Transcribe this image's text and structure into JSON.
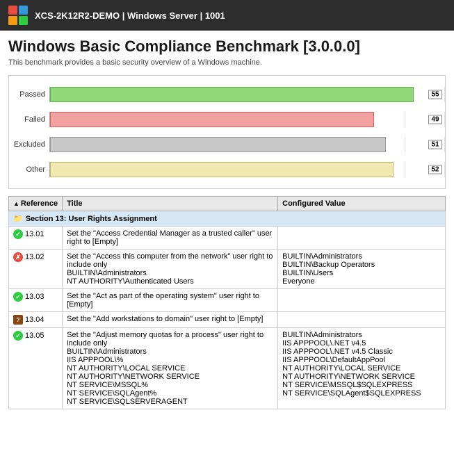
{
  "header": {
    "title": "XCS-2K12R2-DEMO | Windows Server | 1001",
    "icon_colors": [
      "#e74c3c",
      "#3498db",
      "#f39c12",
      "#2ecc40"
    ]
  },
  "page": {
    "title": "Windows Basic Compliance Benchmark [3.0.0.0]",
    "subtitle": "This benchmark provides a basic security overview of a Windows machine."
  },
  "chart": {
    "bars": [
      {
        "label": "Passed",
        "value": 55,
        "color": "#90d878",
        "border": "#5ab84b",
        "pct": 92
      },
      {
        "label": "Failed",
        "value": 49,
        "color": "#f2a0a0",
        "border": "#e06060",
        "pct": 82
      },
      {
        "label": "Excluded",
        "value": 51,
        "color": "#c8c8c8",
        "border": "#999",
        "pct": 85
      },
      {
        "label": "Other",
        "value": 52,
        "color": "#f0e8b0",
        "border": "#c8b860",
        "pct": 87
      }
    ]
  },
  "table": {
    "headers": {
      "reference": "Reference",
      "title": "Title",
      "configured_value": "Configured Value"
    },
    "section_label": "Section 13: User Rights Assignment",
    "rows": [
      {
        "id": "13.01",
        "status": "pass",
        "title": "Set the \"Access Credential Manager as a trusted caller\" user right to [Empty]",
        "configured_value": ""
      },
      {
        "id": "13.02",
        "status": "fail",
        "title": "Set the \"Access this computer from the network\" user right to include only\nBUILTIN\\Administrators\nNT AUTHORITY\\Authenticated Users",
        "configured_value": "BUILTIN\\Administrators\nBUILTIN\\Backup Operators\nBUILTIN\\Users\nEveryone"
      },
      {
        "id": "13.03",
        "status": "pass",
        "title": "Set the \"Act as part of the operating system\" user right to [Empty]",
        "configured_value": ""
      },
      {
        "id": "13.04",
        "status": "other",
        "title": "Set the \"Add workstations to domain\" user right to [Empty]",
        "configured_value": ""
      },
      {
        "id": "13.05",
        "status": "pass",
        "title": "Set the \"Adjust memory quotas for a process\" user right to include only\nBUILTIN\\Administrators\nIIS APPPOOL\\%\nNT AUTHORITY\\LOCAL SERVICE\nNT AUTHORITY\\NETWORK SERVICE\nNT SERVICE\\MSSQL%\nNT SERVICE\\SQLAgent%\nNT SERVICE\\SQLSERVERAGENT",
        "configured_value": "BUILTIN\\Administrators\nIIS APPPOOL\\.NET v4.5\nIIS APPPOOL\\.NET v4.5 Classic\nIIS APPPOOL\\DefaultAppPool\nNT AUTHORITY\\LOCAL SERVICE\nNT AUTHORITY\\NETWORK SERVICE\nNT SERVICE\\MSSQL$SQLEXPRESS\nNT SERVICE\\SQLAgent$SQLEXPRESS"
      }
    ]
  }
}
